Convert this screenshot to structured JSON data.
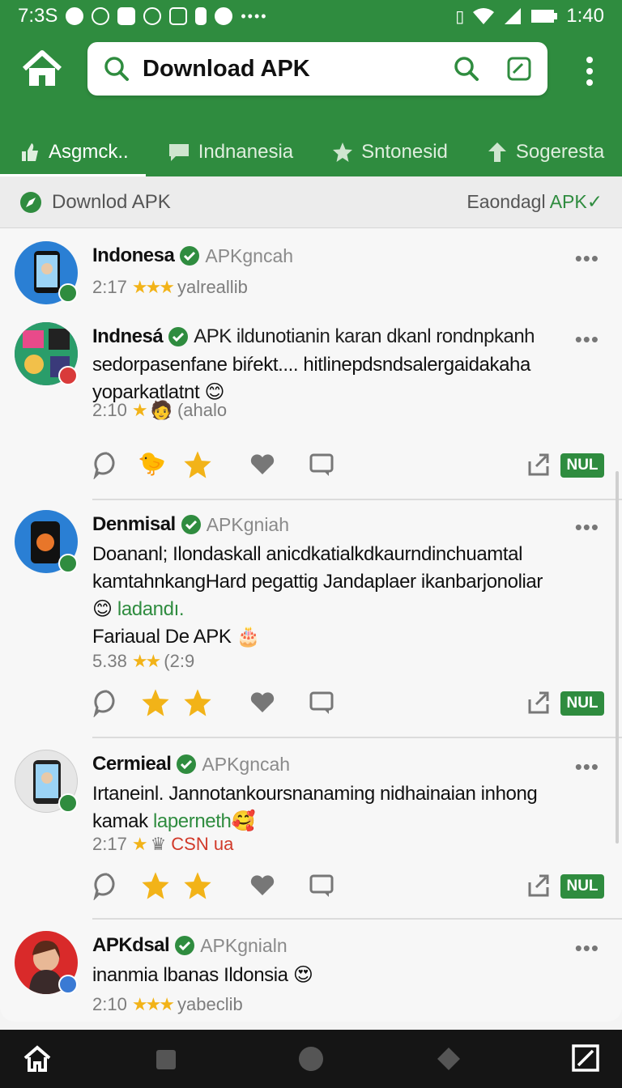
{
  "status_bar": {
    "time_left": "7:3S",
    "time_right": "1:40",
    "dots": "••••"
  },
  "search": {
    "query": "Download APK"
  },
  "tabs": [
    {
      "label": "Asgmck..",
      "icon": "thumb-icon"
    },
    {
      "label": "Indnanesia",
      "icon": "chat-icon"
    },
    {
      "label": "Sntonesid",
      "icon": "star-icon"
    },
    {
      "label": "Sogeresta",
      "icon": "upload-icon"
    }
  ],
  "subbar": {
    "title": "Downlod APK",
    "right_prefix": "Eaondagl",
    "right_accent": "APK"
  },
  "posts": [
    {
      "name": "Indonesa",
      "handle": "APKgncah",
      "time": "2:17",
      "stars": "★★★",
      "meta": "yalreallib"
    },
    {
      "name": "Indnesá",
      "inline": "APK ildunotianin karan dkanl rondnpkanh",
      "line2": "sedorpasenfane biŕekt.... hitlinepdsndsalergaidakaha",
      "line3": "yoparkatlatnt",
      "time": "2:10",
      "stars": "★",
      "meta": "(ahalo"
    },
    {
      "name": "Denmisal",
      "handle": "APKgniah",
      "line1": "Doananl; Ilondaskall anicdkatialkdkaurndinchuamtal",
      "line2": "kamtahnkangHard pegattig Jandaplaer ikanbarjonoliar",
      "line3_green": "ladandı.",
      "line4": "Fariaual De APK",
      "time": "5.38",
      "stars": "★★",
      "meta": "(2:9"
    },
    {
      "name": "Cermieal",
      "handle": "APKgncah",
      "line1": "Irtaneinl. Jannotankoursnanaming nidhainaian inhong",
      "line2_a": "kamak",
      "line2_green": "laperneth",
      "time": "2:17",
      "stars": "★",
      "meta_red": "CSN ua"
    },
    {
      "name": "APKdsal",
      "handle": "APKgnialn",
      "line1": "inanmia lbanas Ildonsia",
      "time": "2:10",
      "stars": "★★★",
      "meta": "yabeclib"
    }
  ],
  "nul_label": "NUL",
  "colors": {
    "brand_green": "#2f8c3f",
    "star": "#f2b318",
    "status_red": "#d13a2a"
  }
}
